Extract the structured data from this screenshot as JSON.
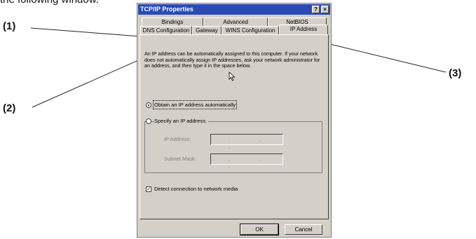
{
  "caption": "the following window.",
  "callouts": [
    "(1)",
    "(2)",
    "(3)"
  ],
  "window": {
    "title": "TCP/IP Properties",
    "help_button": "?",
    "close_button": "×"
  },
  "tabs_row1": [
    "Bindings",
    "Advanced",
    "NetBIOS"
  ],
  "tabs_row2": [
    "DNS Configuration",
    "Gateway",
    "WINS Configuration",
    "IP Address"
  ],
  "active_tab": "IP Address",
  "description": "An IP address can be automatically assigned to this computer. If your network does not automatically assign IP addresses, ask your network administrator for an address, and then type it in the space below.",
  "options": {
    "obtain": "Obtain an IP address automatically",
    "specify": "Specify an IP address:",
    "selected": "obtain"
  },
  "fields": {
    "ip_label": "IP Address:",
    "mask_label": "Subnet Mask:",
    "ip_value": ". . .",
    "mask_value": ". . ."
  },
  "detect": {
    "label": "Detect connection to network media",
    "checked": true,
    "mark": "✓"
  },
  "buttons": {
    "ok": "OK",
    "cancel": "Cancel"
  },
  "colors": {
    "titlebar": "#2a4bb3",
    "dialog": "#d4d0c8",
    "highlight": "#c0262d"
  }
}
